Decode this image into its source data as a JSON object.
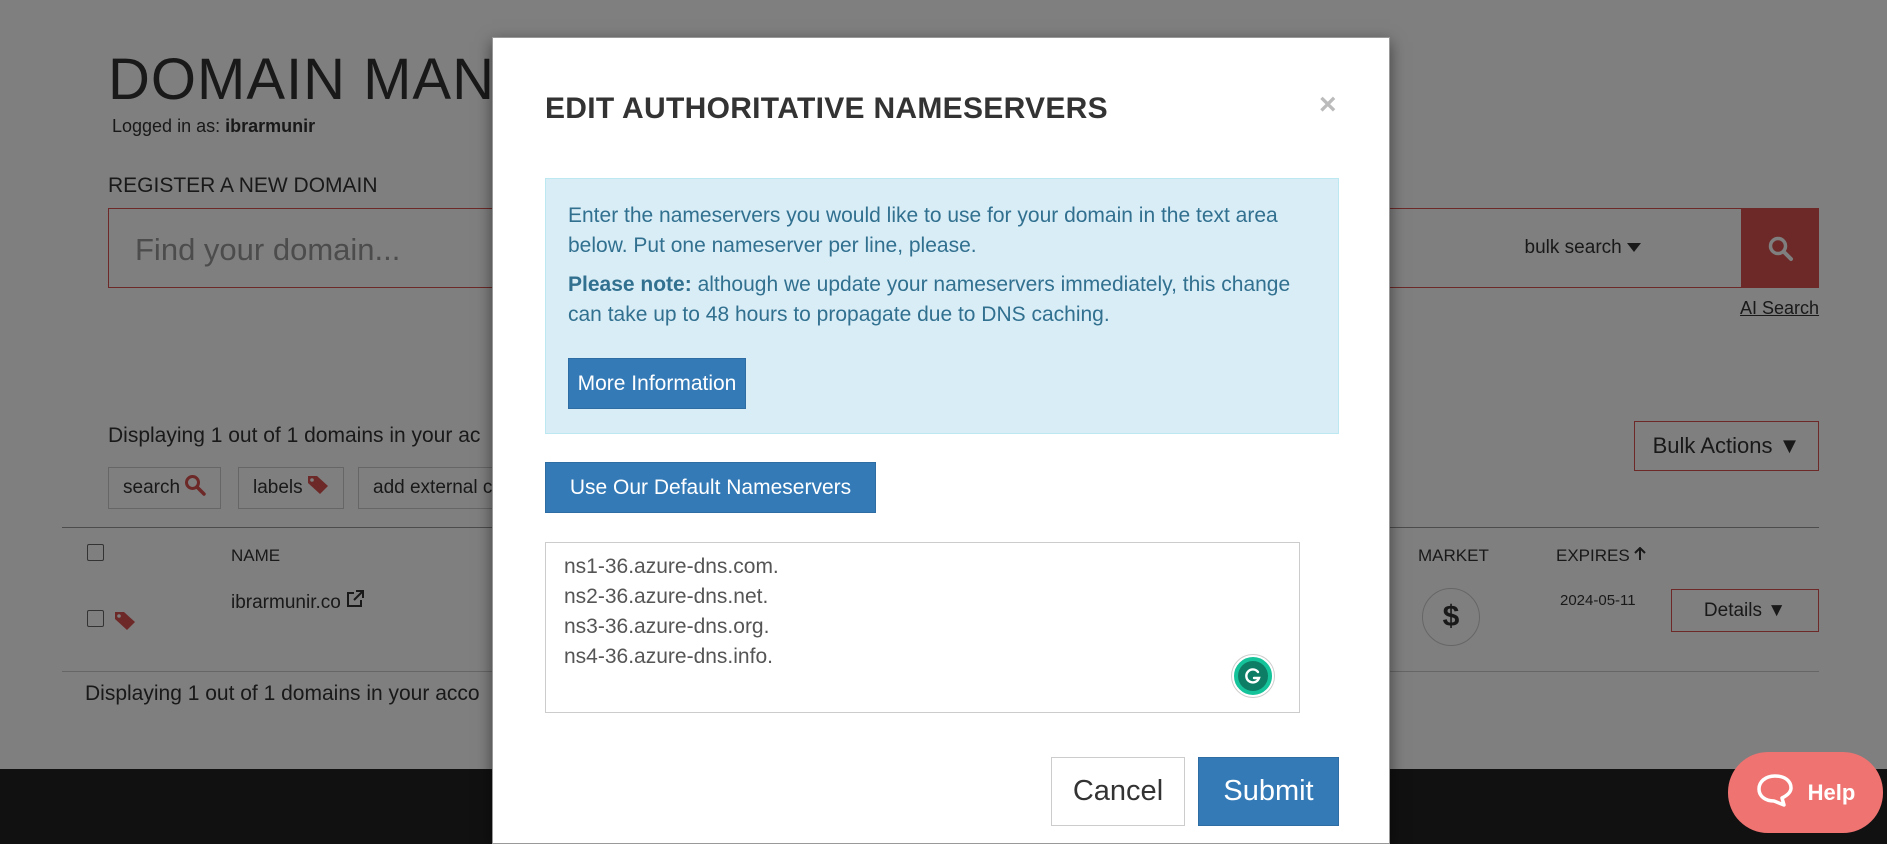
{
  "background": {
    "page_title": "DOMAIN MANA",
    "logged_in_prefix": "Logged in as:",
    "logged_in_user": "ibrarmunir",
    "register_label": "REGISTER A NEW DOMAIN",
    "search_placeholder": "Find your domain...",
    "bulk_search_label": "bulk search",
    "ai_search_label": "AI Search",
    "displaying_top": "Displaying 1 out of 1 domains in your ac",
    "bulk_actions_label": "Bulk Actions ▼",
    "filters": {
      "search": "search",
      "labels": "labels",
      "add_external": "add external c"
    },
    "table": {
      "headers": {
        "name": "NAME",
        "market": "MARKET",
        "expires": "EXPIRES"
      },
      "rows": [
        {
          "name": "ibrarmunir.co",
          "market_symbol": "$",
          "expires": "2024-05-11",
          "details_label": "Details ▼"
        }
      ]
    },
    "displaying_bottom": "Displaying 1 out of 1 domains in your acco"
  },
  "modal": {
    "title": "EDIT AUTHORITATIVE NAMESERVERS",
    "close_symbol": "×",
    "info_paragraph_1": "Enter the nameservers you would like to use for your domain in the text area below. Put one nameserver per line, please.",
    "info_note_label": "Please note:",
    "info_paragraph_2": "although we update your nameservers immediately, this change can take up to 48 hours to propagate due to DNS caching.",
    "more_info_label": "More Information",
    "default_ns_label": "Use Our Default Nameservers",
    "nameservers": [
      "ns1-36.azure-dns.com.",
      "ns2-36.azure-dns.net.",
      "ns3-36.azure-dns.org.",
      "ns4-36.azure-dns.info."
    ],
    "cancel_label": "Cancel",
    "submit_label": "Submit"
  },
  "help_widget": {
    "label": "Help"
  },
  "colors": {
    "accent_red": "#d9534f",
    "primary_blue": "#337ab7",
    "info_bg": "#d9edf7",
    "info_text": "#31708f",
    "help_pink": "#ef7371",
    "footer_dark": "#222222"
  },
  "icons": [
    "search-icon",
    "tag-icon",
    "external-link-icon",
    "caret-down-icon",
    "arrow-up-icon",
    "close-icon",
    "grammarly-icon",
    "chat-bubble-icon"
  ]
}
